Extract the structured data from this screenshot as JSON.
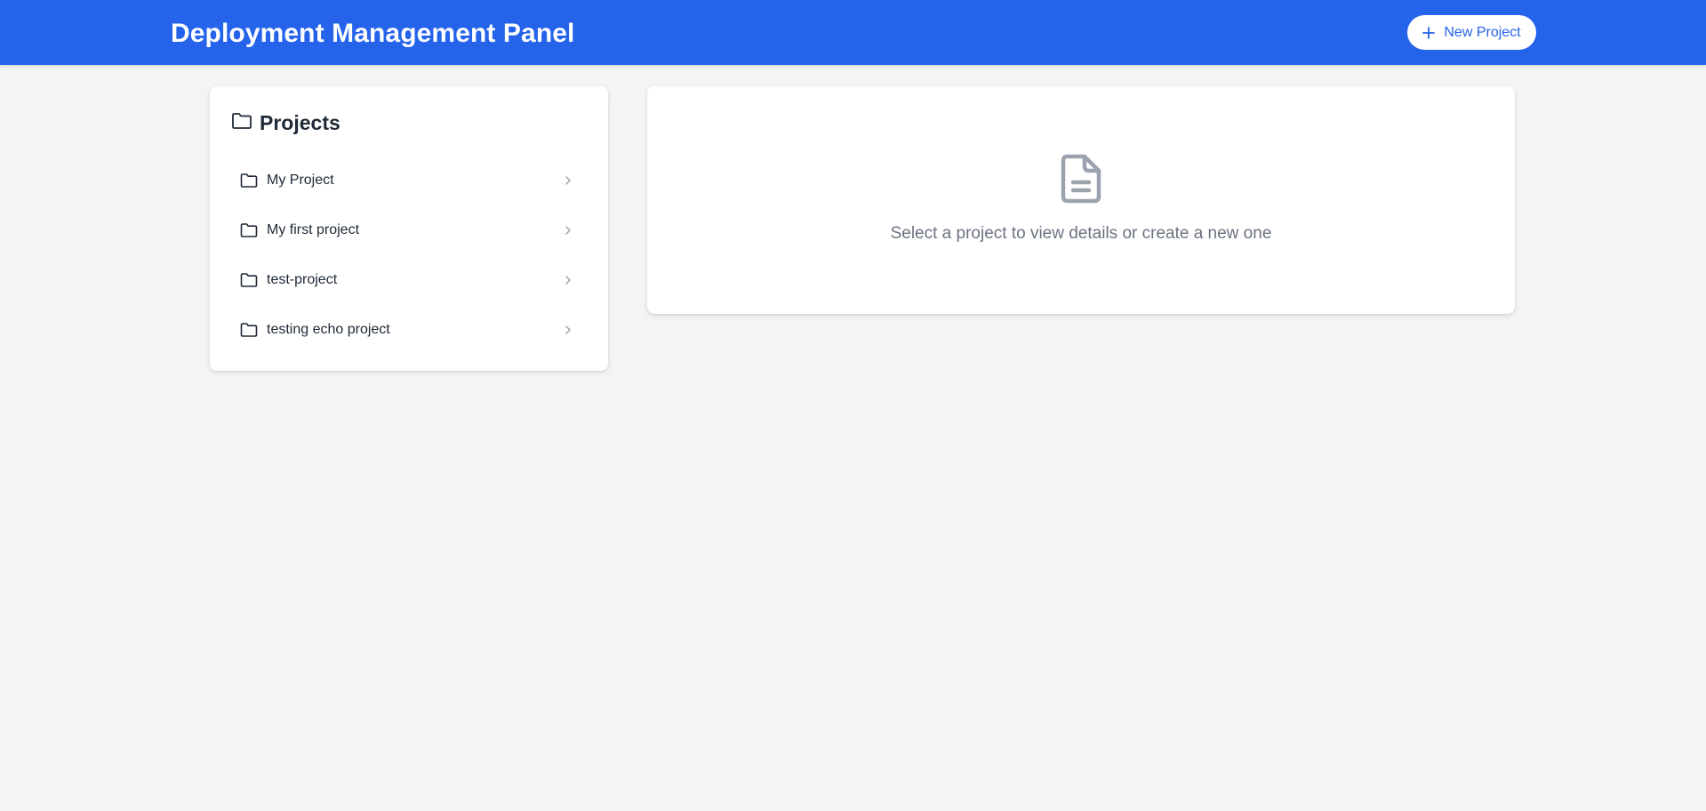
{
  "header": {
    "title": "Deployment Management Panel",
    "new_project_label": "New Project",
    "new_project_icon": "plus-icon",
    "background_color": "#2563eb"
  },
  "sidebar": {
    "title": "Projects",
    "title_icon": "folder-icon",
    "items": [
      {
        "label": "My Project",
        "icon": "folder-icon"
      },
      {
        "label": "My first project",
        "icon": "folder-icon"
      },
      {
        "label": "test-project",
        "icon": "folder-icon"
      },
      {
        "label": "testing echo project",
        "icon": "folder-icon"
      }
    ]
  },
  "details": {
    "icon": "document-icon",
    "empty_message": "Select a project to view details or create a new one"
  },
  "colors": {
    "accent": "#2563eb",
    "page_background": "#f3f4f6",
    "muted_text": "#6b7280"
  }
}
